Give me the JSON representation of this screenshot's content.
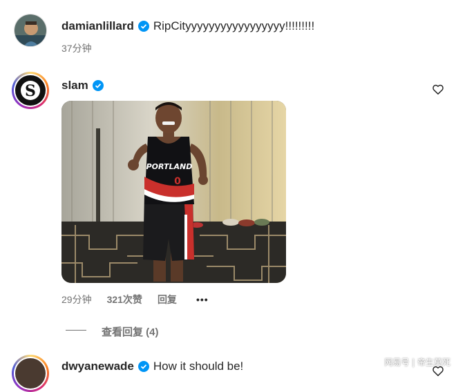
{
  "comments": [
    {
      "username": "damianlillard",
      "verified": true,
      "text": "RipCityyyyyyyyyyyyyyyyy!!!!!!!!!",
      "time": "37分钟"
    },
    {
      "username": "slam",
      "verified": true,
      "time": "29分钟",
      "likes": "321次赞",
      "reply_label": "回复",
      "more_label": "•••",
      "media": {
        "jersey_text": "PORTLAND",
        "jersey_number": "0"
      },
      "view_replies": "查看回复 (4)"
    },
    {
      "username": "dwyanewade",
      "verified": true,
      "text": "How it should be!"
    }
  ],
  "watermark": "网易号 | 帝生莫死",
  "colors": {
    "verified": "#0095f6",
    "secondary_text": "#737373",
    "primary_text": "#262626"
  },
  "icons": [
    "verified-badge-icon",
    "heart-icon",
    "more-options-icon"
  ]
}
